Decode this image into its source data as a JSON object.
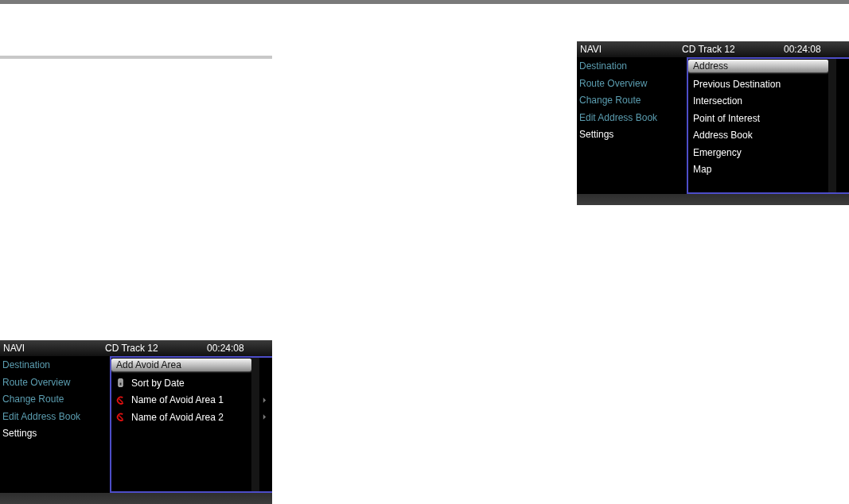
{
  "screens": [
    {
      "status_bar": {
        "mode": "NAVI",
        "source": "CD Track 12",
        "time": "00:24:08"
      },
      "menu": [
        {
          "label": "Destination",
          "color": "#5b9db0"
        },
        {
          "label": "Route Overview",
          "color": "#5b9db0"
        },
        {
          "label": "Change Route",
          "color": "#5b9db0"
        },
        {
          "label": "Edit Address Book",
          "color": "#5b9db0"
        },
        {
          "label": "Settings",
          "color": "#ffffff"
        }
      ],
      "list": [
        {
          "label": "Add Avoid Area",
          "selected": true,
          "kind": "plain",
          "submenu": false
        },
        {
          "label": "Sort by Date",
          "selected": false,
          "kind": "sort",
          "submenu": false
        },
        {
          "label": "Name of Avoid Area 1",
          "selected": false,
          "kind": "avoid",
          "submenu": true
        },
        {
          "label": "Name of Avoid Area 2",
          "selected": false,
          "kind": "avoid",
          "submenu": true
        }
      ]
    },
    {
      "status_bar": {
        "mode": "NAVI",
        "source": "CD Track 12",
        "time": "00:24:08"
      },
      "menu": [
        {
          "label": "Destination",
          "color": "#5b9db0"
        },
        {
          "label": "Route Overview",
          "color": "#5b9db0"
        },
        {
          "label": "Change Route",
          "color": "#5b9db0"
        },
        {
          "label": "Edit Address Book",
          "color": "#5b9db0"
        },
        {
          "label": "Settings",
          "color": "#ffffff"
        }
      ],
      "list": [
        {
          "label": "Address",
          "selected": true,
          "kind": "plain",
          "submenu": false
        },
        {
          "label": "Previous Destination",
          "selected": false,
          "kind": "plain",
          "submenu": false
        },
        {
          "label": "Intersection",
          "selected": false,
          "kind": "plain",
          "submenu": false
        },
        {
          "label": "Point of Interest",
          "selected": false,
          "kind": "plain",
          "submenu": false
        },
        {
          "label": "Address Book",
          "selected": false,
          "kind": "plain",
          "submenu": false
        },
        {
          "label": "Emergency",
          "selected": false,
          "kind": "plain",
          "submenu": false
        },
        {
          "label": "Map",
          "selected": false,
          "kind": "plain",
          "submenu": false
        }
      ]
    }
  ]
}
